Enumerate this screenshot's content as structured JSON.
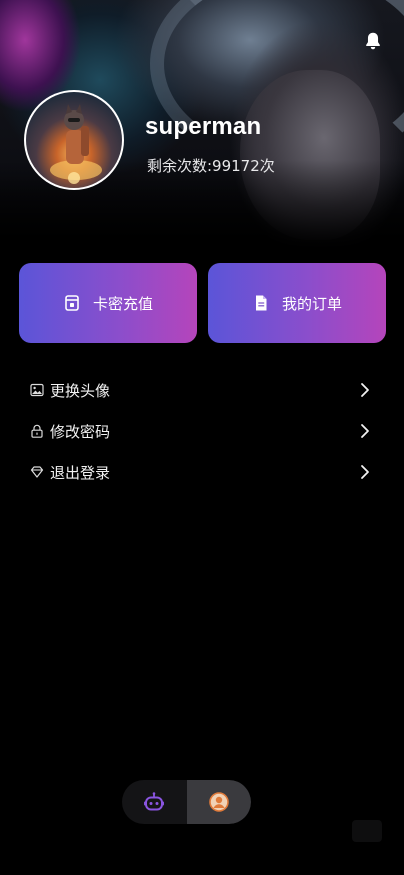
{
  "profile": {
    "username": "superman",
    "remaining_uses": "剩余次数:99172次"
  },
  "actions": {
    "recharge_label": "卡密充值",
    "orders_label": "我的订单"
  },
  "menu": {
    "items": [
      {
        "label": "更换头像",
        "icon": "image-icon"
      },
      {
        "label": "修改密码",
        "icon": "lock-icon"
      },
      {
        "label": "退出登录",
        "icon": "diamond-icon"
      }
    ]
  },
  "tabbar": {
    "tabs": [
      {
        "icon": "robot-icon",
        "active": false
      },
      {
        "icon": "user-icon",
        "active": true
      }
    ]
  },
  "colors": {
    "background": "#000000",
    "card_gradient_start": "#5b55d8",
    "card_gradient_end": "#b545bb",
    "tab_robot": "#8a55e0",
    "tab_user": "#e07a3a"
  }
}
